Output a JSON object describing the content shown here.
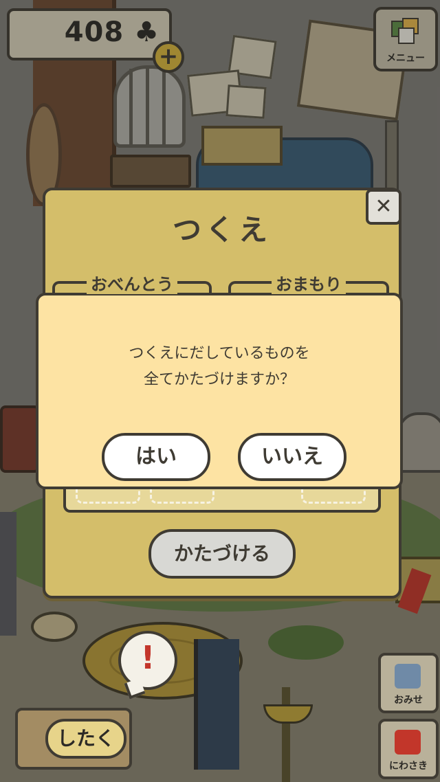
{
  "hud": {
    "clover_count": "408 ♣",
    "menu_label": "メニュー",
    "omise_label": "おみせ",
    "niwasaki_label": "にわさき",
    "shitaku_label": "したく"
  },
  "desk": {
    "title": "つくえ",
    "section_bento": "おべんとう",
    "section_omamori": "おまもり",
    "put_away_label": "かたづける",
    "close_glyph": "✕"
  },
  "dialog": {
    "line1": "つくえにだしているものを",
    "line2": "全てかたづけますか？",
    "yes_label": "はい",
    "no_label": "いいえ"
  },
  "alert_glyph": "!",
  "colors": {
    "panel": "#d4be6a",
    "dialog": "#fde3a3",
    "outline": "#3f3b33",
    "alert": "#c3362b"
  }
}
